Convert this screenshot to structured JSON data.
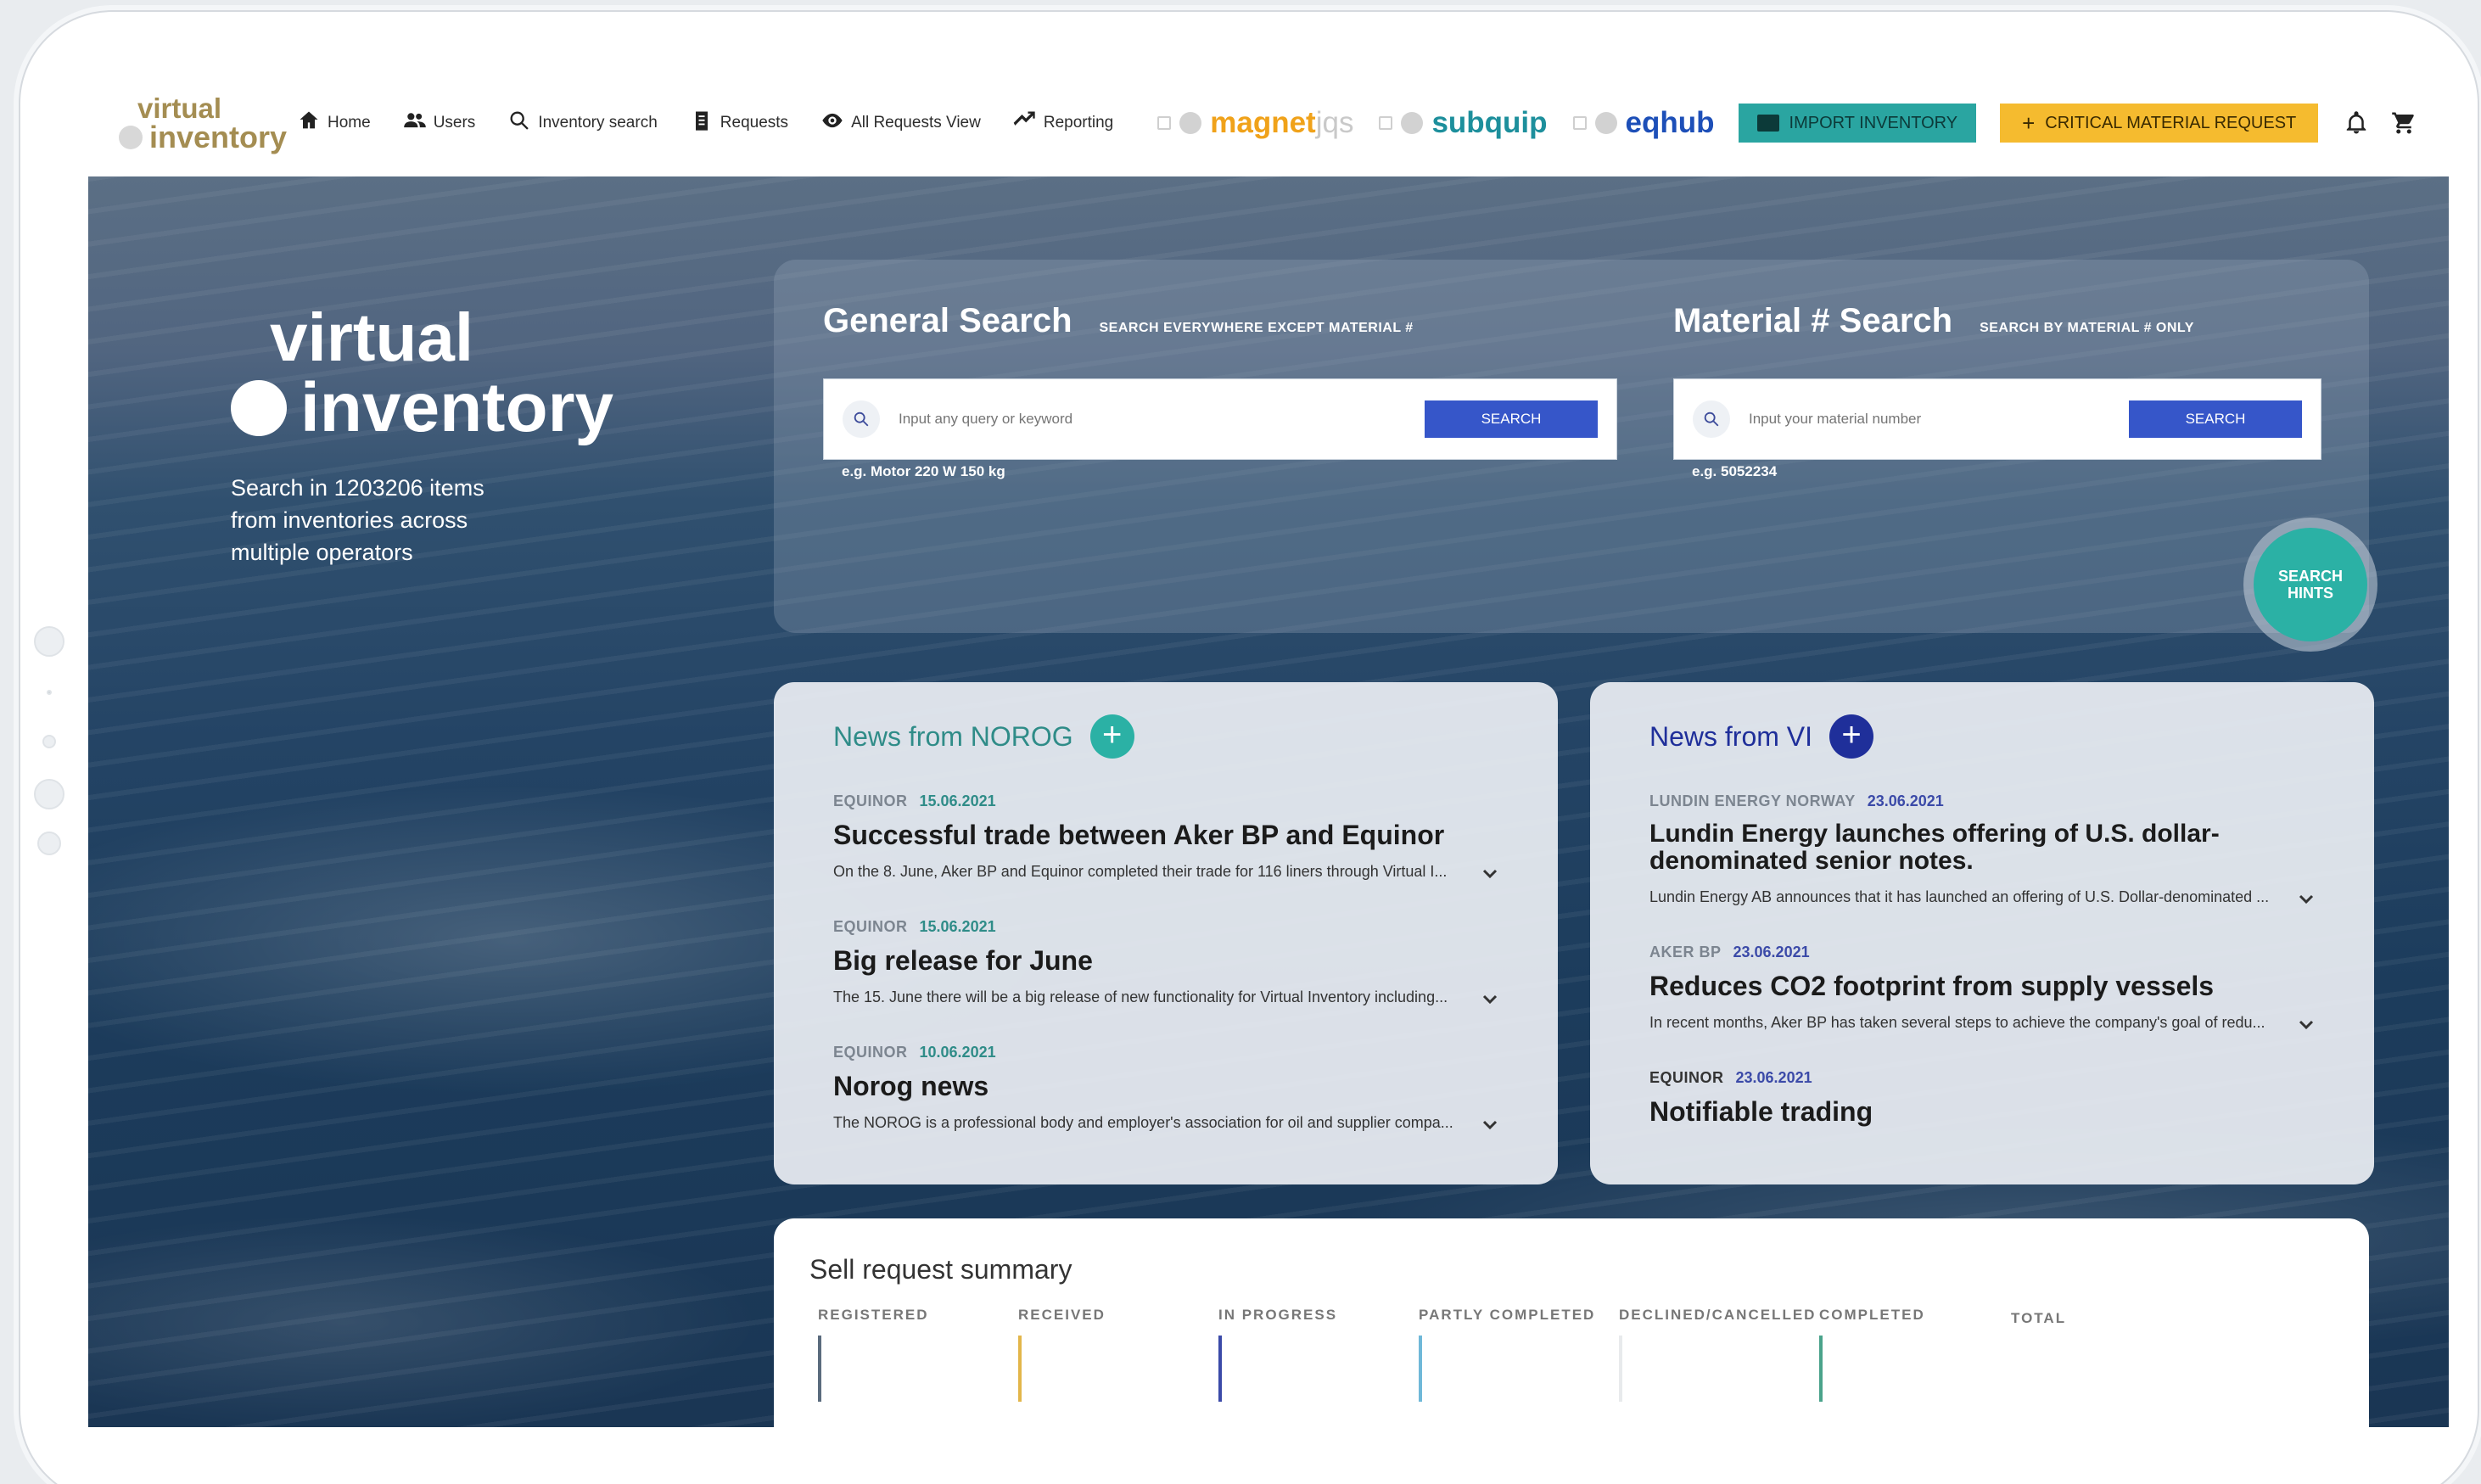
{
  "app": {
    "logo_line1": "virtual",
    "logo_line2": "inventory"
  },
  "nav": [
    {
      "label": "Home",
      "icon": "home-icon"
    },
    {
      "label": "Users",
      "icon": "users-icon"
    },
    {
      "label": "Inventory search",
      "icon": "search-icon"
    },
    {
      "label": "Requests",
      "icon": "clipboard-icon"
    },
    {
      "label": "All Requests View",
      "icon": "eye-icon"
    },
    {
      "label": "Reporting",
      "icon": "trend-icon"
    }
  ],
  "partners": {
    "magnet_a": "magnet",
    "magnet_b": "jqs",
    "subquip": "subquip",
    "eqhub": "eqhub"
  },
  "header_buttons": {
    "import": "IMPORT INVENTORY",
    "critical": "CRITICAL MATERIAL REQUEST"
  },
  "hero": {
    "logo_line1": "virtual",
    "logo_line2": "inventory",
    "subtitle": "Search in 1203206 items from inventories across multiple operators"
  },
  "general_search": {
    "title": "General Search",
    "subtitle": "SEARCH EVERYWHERE EXCEPT MATERIAL #",
    "placeholder": "Input any query or keyword",
    "button": "SEARCH",
    "example": "e.g. Motor 220 W 150 kg"
  },
  "material_search": {
    "title": "Material # Search",
    "subtitle": "SEARCH BY MATERIAL # ONLY",
    "placeholder": "Input your material number",
    "button": "SEARCH",
    "example": "e.g. 5052234"
  },
  "hints": {
    "label": "SEARCH HINTS"
  },
  "news_norog": {
    "title": "News from NOROG",
    "items": [
      {
        "source": "EQUINOR",
        "date": "15.06.2021",
        "title": "Successful trade between Aker BP and Equinor",
        "summary": "On the 8. June, Aker BP and Equinor completed their trade for 116 liners through Virtual I..."
      },
      {
        "source": "EQUINOR",
        "date": "15.06.2021",
        "title": "Big release for June",
        "summary": "The 15. June there will be a big release of new functionality for Virtual Inventory including..."
      },
      {
        "source": "EQUINOR",
        "date": "10.06.2021",
        "title": "Norog news",
        "summary": "The NOROG is a professional body and employer's association for oil and supplier compa..."
      }
    ]
  },
  "news_vi": {
    "title": "News from VI",
    "items": [
      {
        "source": "LUNDIN ENERGY NORWAY",
        "date": "23.06.2021",
        "title": "Lundin Energy launches offering of U.S. dollar-denominated senior notes.",
        "summary": "Lundin Energy AB announces that it has launched an offering of U.S. Dollar-denominated ..."
      },
      {
        "source": "AKER BP",
        "date": "23.06.2021",
        "title": "Reduces CO2 footprint from supply vessels",
        "summary": "In recent months, Aker BP has taken several steps to achieve the company's goal of redu..."
      },
      {
        "source": "EQUINOR",
        "date": "23.06.2021",
        "title": "Notifiable trading",
        "summary": ""
      }
    ]
  },
  "summary": {
    "title": "Sell request summary",
    "stats": [
      {
        "label": "REGISTERED",
        "color": "#5a6b7d"
      },
      {
        "label": "RECEIVED",
        "color": "#e3b64a"
      },
      {
        "label": "IN PROGRESS",
        "color": "#3b4aa8"
      },
      {
        "label": "PARTLY COMPLETED",
        "color": "#6fb8d8"
      },
      {
        "label": "DECLINED/CANCELLED",
        "color": "#e8eaec"
      },
      {
        "label": "COMPLETED",
        "color": "#4aa38b"
      },
      {
        "label": "TOTAL",
        "color": ""
      }
    ]
  },
  "colors": {
    "brand_gold": "#a48d52",
    "teal": "#2aa5a1",
    "amber": "#f5bb2f",
    "search_blue": "#3656c9",
    "magnet_orange": "#f0a21a",
    "subquip_teal": "#1d8f9c",
    "eqhub_blue": "#1d4fb8",
    "norog_teal": "#2f8c88",
    "vi_navy": "#1f2f9a"
  }
}
